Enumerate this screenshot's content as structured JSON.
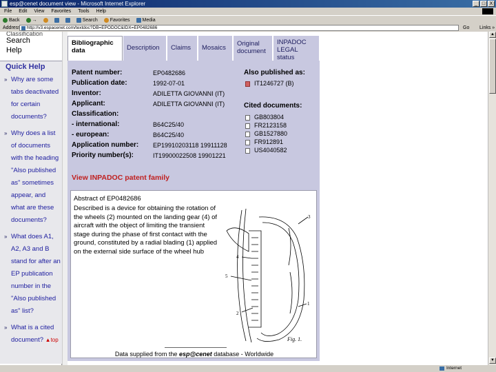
{
  "window": {
    "title": "esp@cenet document view - Microsoft Internet Explorer",
    "buttons": [
      "_",
      "□",
      "X"
    ]
  },
  "menu": [
    "File",
    "Edit",
    "View",
    "Favorites",
    "Tools",
    "Help"
  ],
  "toolbar": {
    "back": "Back",
    "forward": "→",
    "search": "Search",
    "favorites": "Favorites",
    "media": "Media"
  },
  "address": {
    "label": "Address",
    "url": "http://v3.espacenet.com/textdoc?DB=EPODOC&IDX=EP0482686",
    "go": "Go",
    "links": "Links »"
  },
  "status": {
    "zone": "Internet"
  },
  "left_frame": {
    "cut_text": "Classification",
    "search": "Search",
    "help": "Help",
    "quick_help_title": "Quick Help",
    "items": [
      "Why are some tabs deactivated for certain documents?",
      "Why does a list of documents with the heading \"Also published as\" sometimes appear, and what are these documents?",
      "What does A1, A2, A3 and B stand for after an EP publication number in the \"Also published as\" list?",
      "What is a cited document?"
    ],
    "top_link": "top"
  },
  "tabs": [
    {
      "label": "Bibliographic data",
      "active": true
    },
    {
      "label": "Description",
      "active": false
    },
    {
      "label": "Claims",
      "active": false
    },
    {
      "label": "Mosaics",
      "active": false
    },
    {
      "label": "Original document",
      "active": false
    },
    {
      "label": "INPADOC LEGAL status",
      "active": false
    }
  ],
  "biblio": {
    "patent_number_label": "Patent number:",
    "patent_number": "EP0482686",
    "publication_date_label": "Publication date:",
    "publication_date": "1992-07-01",
    "inventor_label": "Inventor:",
    "inventor": "ADILETTA GIOVANNI (IT)",
    "applicant_label": "Applicant:",
    "applicant": "ADILETTA GIOVANNI (IT)",
    "classification_label": "Classification:",
    "international_label": "- international:",
    "international": "B64C25/40",
    "european_label": "- european:",
    "european": "B64C25/40",
    "application_number_label": "Application number:",
    "application_number": "EP19910203118 19911128",
    "priority_numbers_label": "Priority number(s):",
    "priority_numbers": "IT19900022508 19901221",
    "also_published_label": "Also published as:",
    "also_published": [
      "IT1246727 (B)"
    ],
    "cited_label": "Cited documents:",
    "cited": [
      "GB803804",
      "FR2123158",
      "GB1527880",
      "FR912891",
      "US4040582"
    ],
    "inpadoc_link": "View INPADOC patent family"
  },
  "abstract": {
    "title": "Abstract of EP0482686",
    "text": "Described is a device for obtaining the rotation of the wheels (2) mounted on the landing gear (4) of aircraft with the object of limiting the transient stage during the phase of first contact with the ground, constituted by a radial blading (1) applied on the external side surface of the wheel hub",
    "figure_label": "Fig. 1.",
    "figure_numbers": [
      "1",
      "2",
      "3",
      "4",
      "5"
    ],
    "caption_prefix": "Data supplied from the",
    "caption_brand": "esp@cenet",
    "caption_suffix": "database - Worldwide"
  }
}
